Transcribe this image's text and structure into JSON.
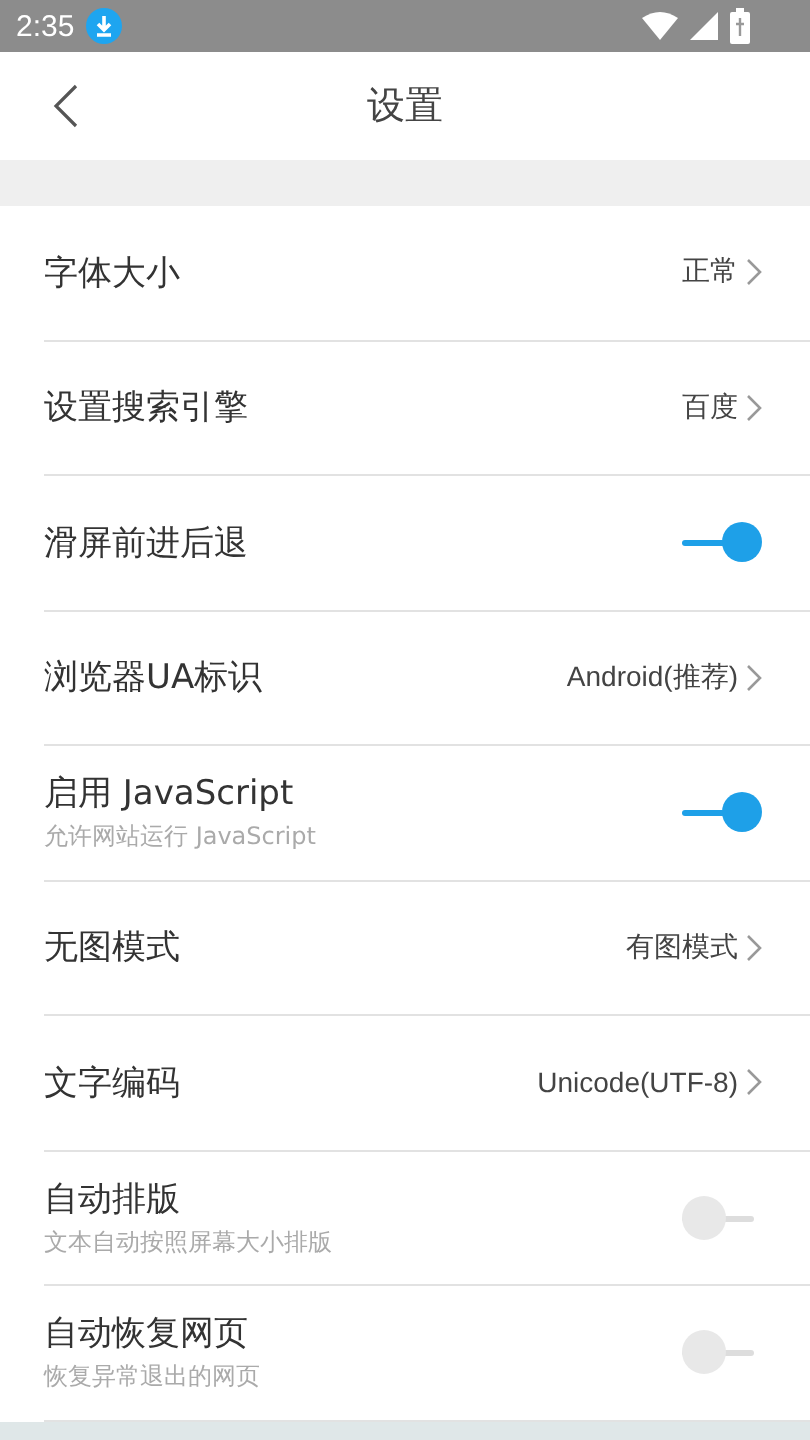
{
  "status_bar": {
    "time": "2:35"
  },
  "header": {
    "title": "设置"
  },
  "settings": [
    {
      "kind": "link",
      "label": "字体大小",
      "value": "正常"
    },
    {
      "kind": "link",
      "label": "设置搜索引擎",
      "value": "百度"
    },
    {
      "kind": "toggle",
      "label": "滑屏前进后退",
      "on": true
    },
    {
      "kind": "link",
      "label": "浏览器UA标识",
      "value": "Android(推荐)"
    },
    {
      "kind": "toggle",
      "label": "启用 JavaScript",
      "sublabel": "允许网站运行 JavaScript",
      "on": true
    },
    {
      "kind": "link",
      "label": "无图模式",
      "value": "有图模式"
    },
    {
      "kind": "link",
      "label": "文字编码",
      "value": "Unicode(UTF-8)"
    },
    {
      "kind": "toggle",
      "label": "自动排版",
      "sublabel": "文本自动按照屏幕大小排版",
      "on": false
    },
    {
      "kind": "toggle",
      "label": "自动恢复网页",
      "sublabel": "恢复异常退出的网页",
      "on": false
    }
  ]
}
